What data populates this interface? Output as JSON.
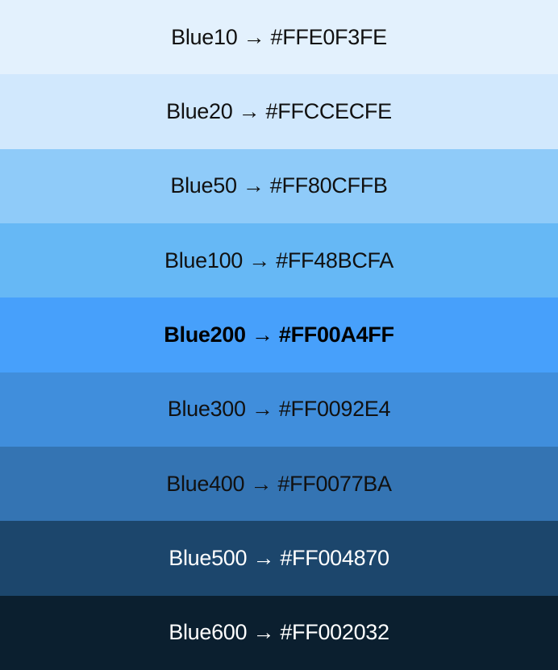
{
  "swatches": [
    {
      "label": "Blue10 → #FFE0F3FE",
      "bg": "#E3F1FD",
      "fg": "#111111",
      "bold": false
    },
    {
      "label": "Blue20 → #FFCCECFE",
      "bg": "#D1E8FD",
      "fg": "#111111",
      "bold": false
    },
    {
      "label": "Blue50 → #FF80CFFB",
      "bg": "#8FCBF9",
      "fg": "#111111",
      "bold": false
    },
    {
      "label": "Blue100 → #FF48BCFA",
      "bg": "#66B8F5",
      "fg": "#111111",
      "bold": false
    },
    {
      "label": "Blue200 → #FF00A4FF",
      "bg": "#47A0FB",
      "fg": "#000000",
      "bold": true
    },
    {
      "label": "Blue300 → #FF0092E4",
      "bg": "#408EDC",
      "fg": "#111111",
      "bold": false
    },
    {
      "label": "Blue400 → #FF0077BA",
      "bg": "#3474B3",
      "fg": "#111111",
      "bold": false
    },
    {
      "label": "Blue500 → #FF004870",
      "bg": "#1C466C",
      "fg": "#FFFFFF",
      "bold": false
    },
    {
      "label": "Blue600 → #FF002032",
      "bg": "#0B1F2F",
      "fg": "#FFFFFF",
      "bold": false
    }
  ]
}
